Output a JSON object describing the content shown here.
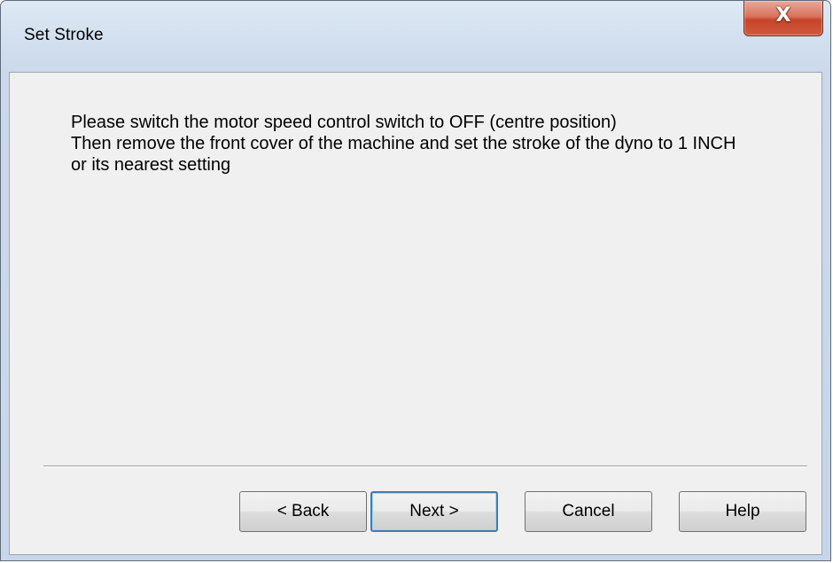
{
  "window": {
    "title": "Set Stroke",
    "close_glyph": "X",
    "close_icon": "close-icon"
  },
  "message": {
    "lines": [
      "Please switch the motor speed control switch to OFF (centre position)",
      "Then remove the front cover of the machine and set the stroke of the dyno to 1 INCH",
      "or its nearest setting"
    ]
  },
  "buttons": {
    "back": "< Back",
    "next": "Next >",
    "cancel": "Cancel",
    "help": "Help",
    "default_button": "next"
  },
  "colors": {
    "close_button": "#c7442a",
    "dialog_face": "#f0f0f0",
    "frame": "#cbd9ea",
    "default_button_border": "#3c7fb1"
  }
}
